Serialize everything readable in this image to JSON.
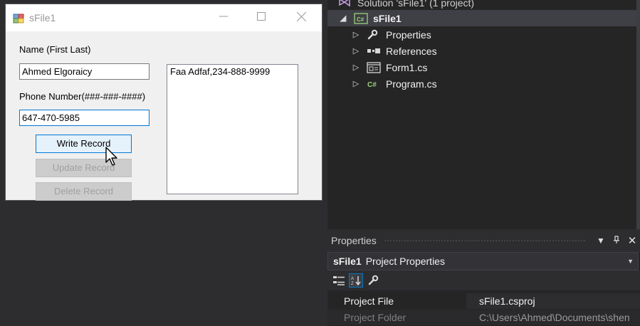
{
  "solution_explorer": {
    "solution_label": "Solution 'sFile1' (1 project)",
    "project_label": "sFile1",
    "items": [
      {
        "label": "Properties",
        "icon": "wrench-icon"
      },
      {
        "label": "References",
        "icon": "references-icon"
      },
      {
        "label": "Form1.cs",
        "icon": "form-icon"
      },
      {
        "label": "Program.cs",
        "icon": "csharp-file-icon"
      }
    ]
  },
  "properties_panel": {
    "title": "Properties",
    "object_name": "sFile1",
    "object_type": "Project Properties",
    "rows": [
      {
        "name": "Project File",
        "value": "sFile1.csproj"
      },
      {
        "name": "Project Folder",
        "value": "C:\\Users\\Ahmed\\Documents\\shen"
      }
    ]
  },
  "form_window": {
    "title": "sFile1",
    "name_label": "Name (First Last)",
    "name_value": "Ahmed Elgoraicy",
    "phone_label": "Phone Number(###-###-####)",
    "phone_value": "647-470-5985",
    "write_button": "Write Record",
    "update_button": "Update Record",
    "delete_button": "Delete Record",
    "list_items": [
      "Faa Adfaf,234-888-9999"
    ]
  },
  "colors": {
    "ide_background": "#2d2d30",
    "panel_background": "#252526",
    "selection": "#3f3f46",
    "accent": "#007acc"
  }
}
